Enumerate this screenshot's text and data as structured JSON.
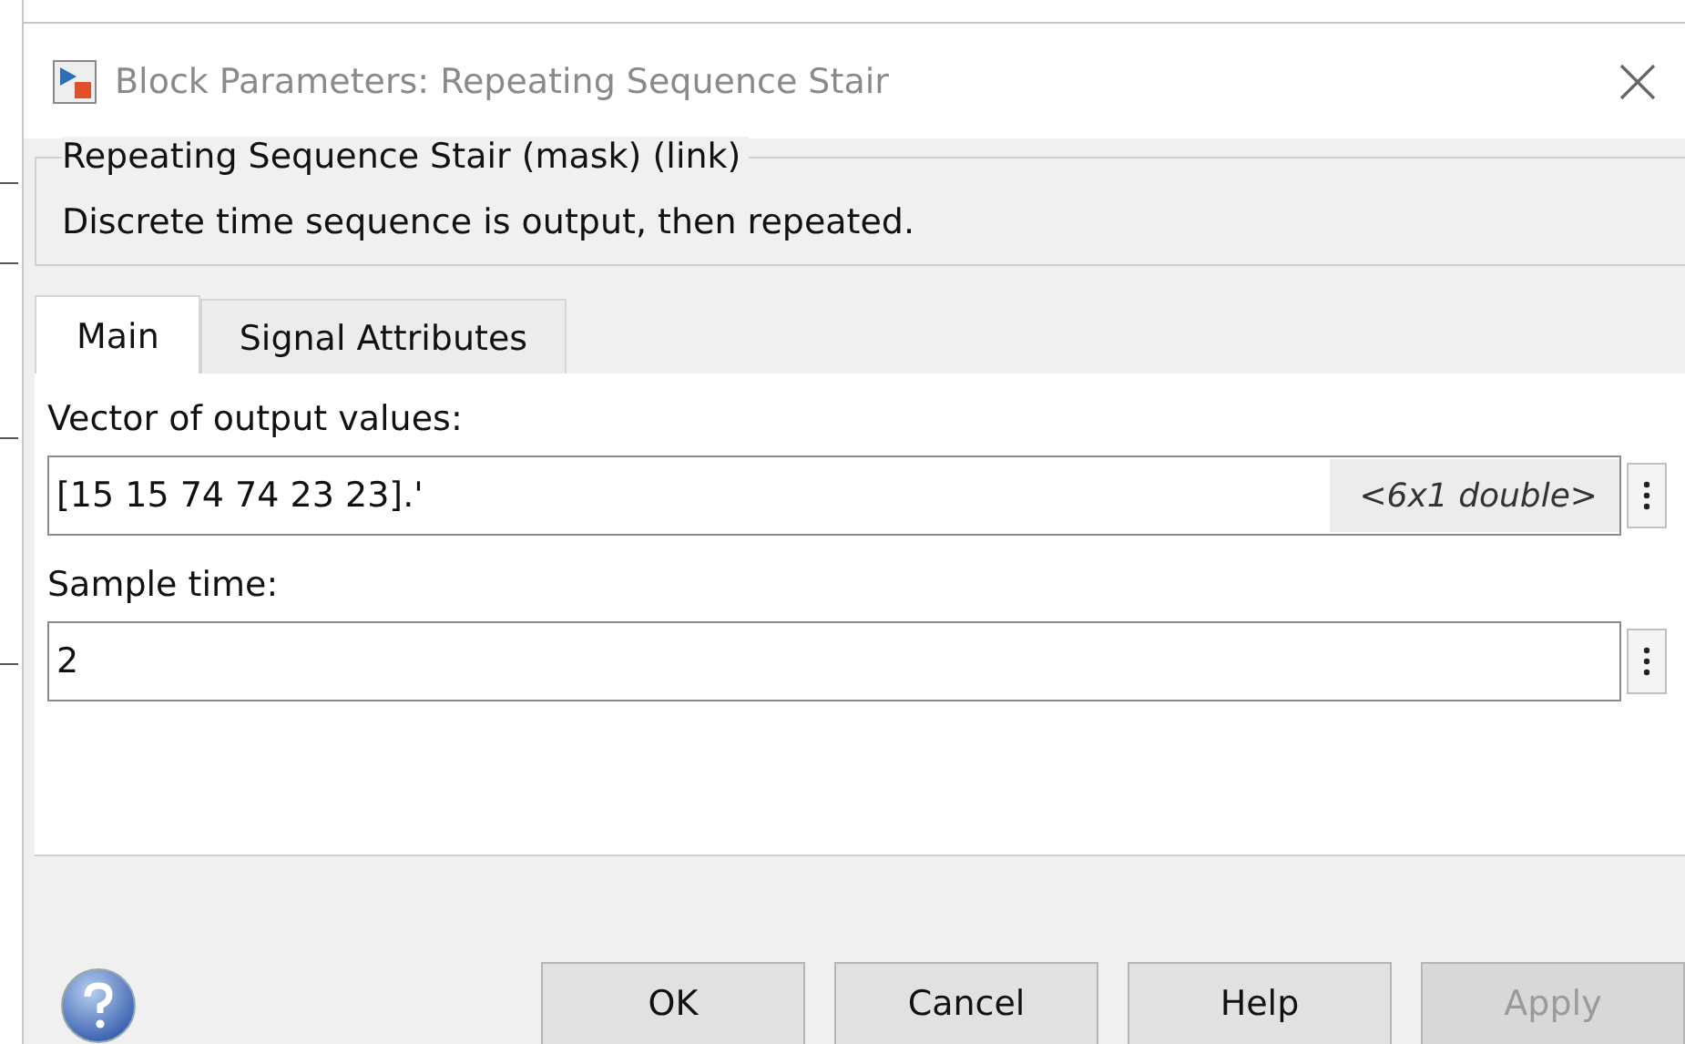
{
  "window": {
    "title": "Block Parameters: Repeating Sequence Stair"
  },
  "group": {
    "title": "Repeating Sequence Stair (mask) (link)",
    "description": "Discrete time sequence is output, then repeated."
  },
  "tabs": [
    {
      "label": "Main",
      "selected": true
    },
    {
      "label": "Signal Attributes",
      "selected": false
    }
  ],
  "parameters": [
    {
      "label": "Vector of output values:",
      "value": "[15 15 74 74 23 23].'",
      "hint": "<6x1 double>"
    },
    {
      "label": "Sample time:",
      "value": "2"
    }
  ],
  "buttons": [
    {
      "label": "OK",
      "disabled": false
    },
    {
      "label": "Cancel",
      "disabled": false
    },
    {
      "label": "Help",
      "disabled": false
    },
    {
      "label": "Apply",
      "disabled": true
    }
  ]
}
